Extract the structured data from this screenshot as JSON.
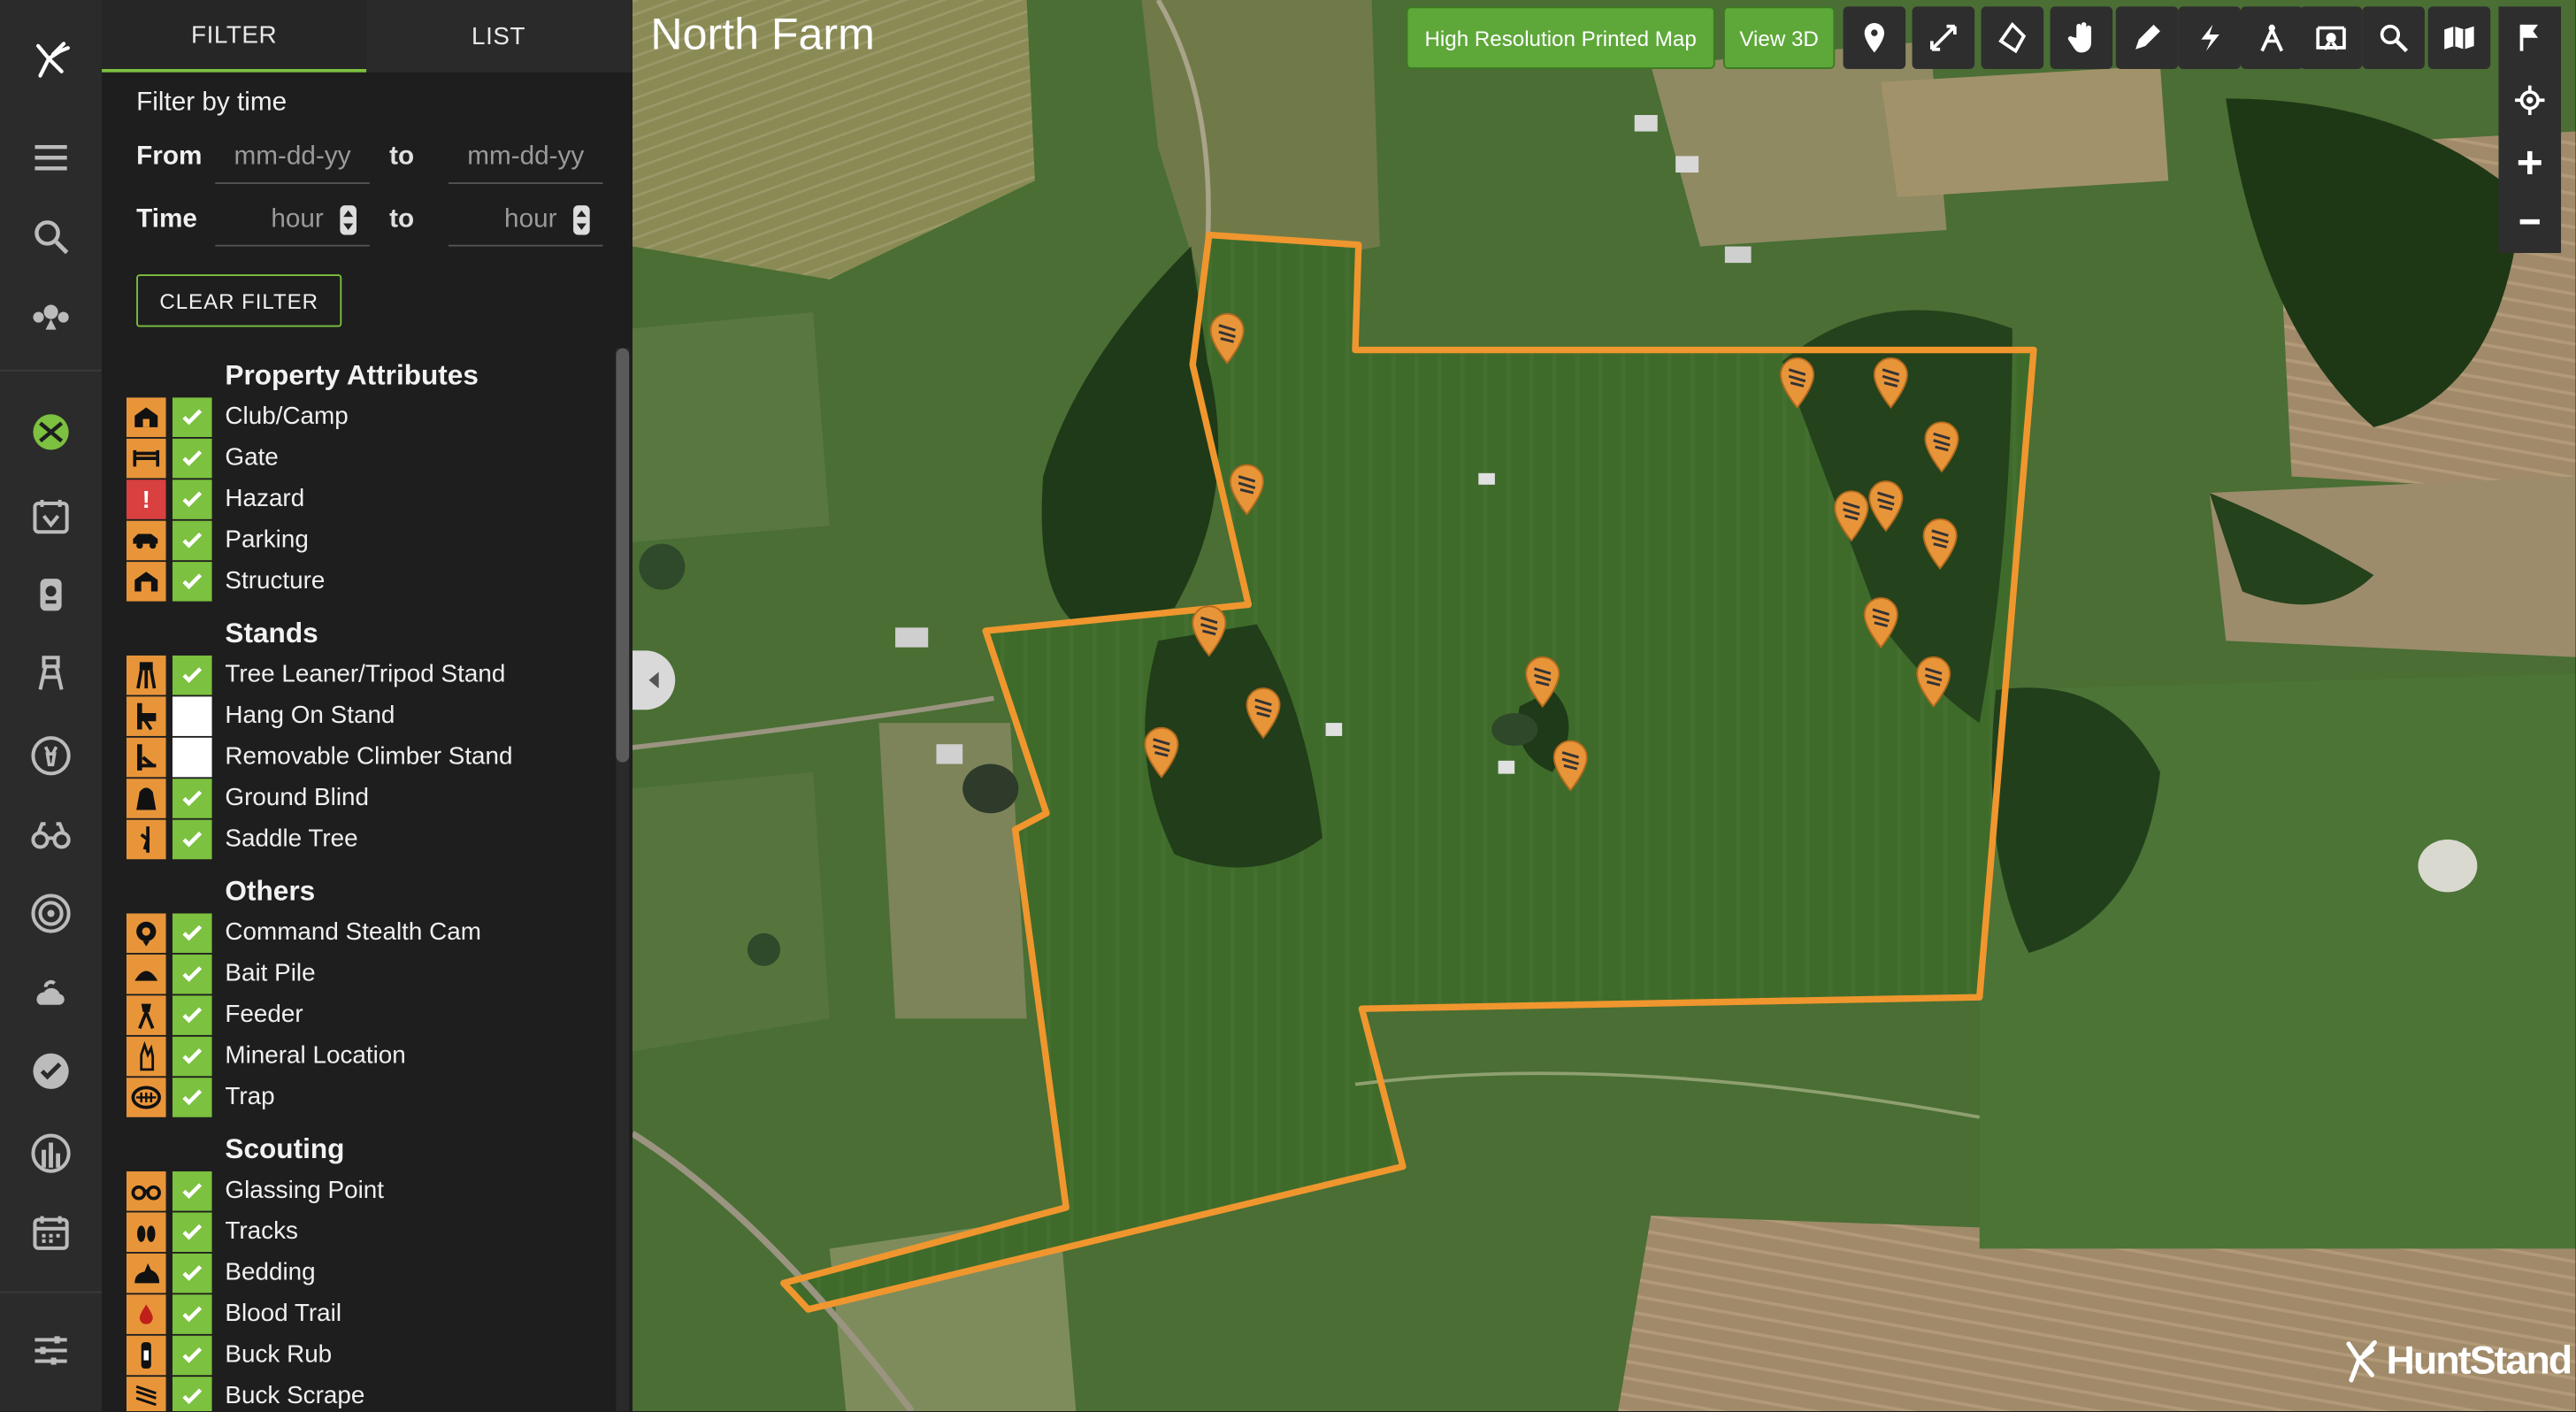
{
  "tabs": [
    {
      "label": "FILTER",
      "active": true
    },
    {
      "label": "LIST",
      "active": false
    }
  ],
  "filter": {
    "title": "Filter by time",
    "from_label": "From",
    "time_label": "Time",
    "to_label": "to",
    "date_placeholder": "mm-dd-yy",
    "hour_placeholder": "hour",
    "clear_label": "CLEAR FILTER"
  },
  "sections": [
    {
      "title": "Property Attributes",
      "items": [
        {
          "label": "Club/Camp",
          "icon": "camp-icon",
          "checked": true
        },
        {
          "label": "Gate",
          "icon": "gate-icon",
          "checked": true
        },
        {
          "label": "Hazard",
          "icon": "hazard-icon",
          "checked": true
        },
        {
          "label": "Parking",
          "icon": "parking-icon",
          "checked": true
        },
        {
          "label": "Structure",
          "icon": "structure-icon",
          "checked": true
        }
      ]
    },
    {
      "title": "Stands",
      "items": [
        {
          "label": "Tree Leaner/Tripod Stand",
          "icon": "tripod-stand-icon",
          "checked": true
        },
        {
          "label": "Hang On Stand",
          "icon": "hang-on-stand-icon",
          "checked": false
        },
        {
          "label": "Removable Climber Stand",
          "icon": "climber-stand-icon",
          "checked": false
        },
        {
          "label": "Ground Blind",
          "icon": "ground-blind-icon",
          "checked": true
        },
        {
          "label": "Saddle Tree",
          "icon": "saddle-tree-icon",
          "checked": true
        }
      ]
    },
    {
      "title": "Others",
      "items": [
        {
          "label": "Command Stealth Cam",
          "icon": "stealth-cam-icon",
          "checked": true
        },
        {
          "label": "Bait Pile",
          "icon": "bait-pile-icon",
          "checked": true
        },
        {
          "label": "Feeder",
          "icon": "feeder-icon",
          "checked": true
        },
        {
          "label": "Mineral Location",
          "icon": "mineral-icon",
          "checked": true
        },
        {
          "label": "Trap",
          "icon": "trap-icon",
          "checked": true
        }
      ]
    },
    {
      "title": "Scouting",
      "items": [
        {
          "label": "Glassing Point",
          "icon": "binoculars-icon",
          "checked": true
        },
        {
          "label": "Tracks",
          "icon": "tracks-icon",
          "checked": true
        },
        {
          "label": "Bedding",
          "icon": "bedding-icon",
          "checked": true
        },
        {
          "label": "Blood Trail",
          "icon": "blood-trail-icon",
          "checked": true
        },
        {
          "label": "Buck Rub",
          "icon": "buck-rub-icon",
          "checked": true
        },
        {
          "label": "Buck Scrape",
          "icon": "buck-scrape-icon",
          "checked": true
        }
      ]
    }
  ],
  "map": {
    "title": "North Farm",
    "print_button": "High Resolution Printed Map",
    "view3d_button": "View 3D",
    "brand": "HuntStand",
    "boundary_color": "#f0962e",
    "pin_color": "#e8953a"
  },
  "colors": {
    "accent": "#7cc13f",
    "rail": "#2b2b2b",
    "panel": "#1e1e1e",
    "marker_orange": "#e8953a",
    "hazard_red": "#d94040"
  }
}
